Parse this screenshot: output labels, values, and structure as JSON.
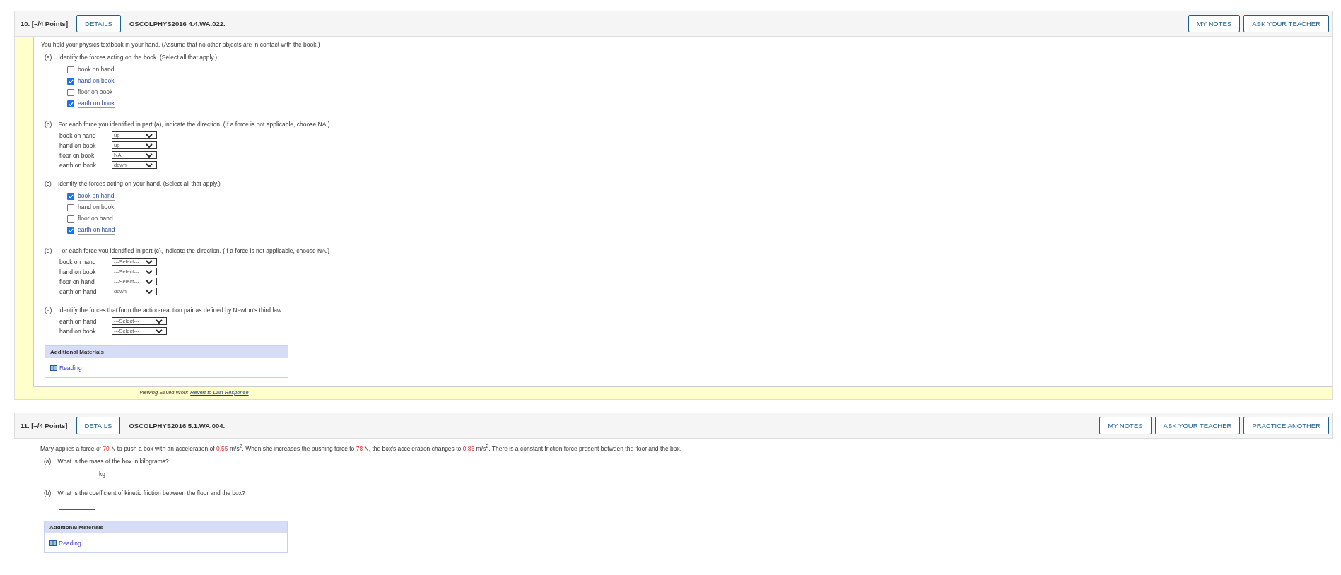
{
  "questions": [
    {
      "number": "10.",
      "points": "[–/4 Points]",
      "details": "DETAILS",
      "code": "OSCOLPHYS2016 4.4.WA.022.",
      "buttons": [
        "MY NOTES",
        "ASK YOUR TEACHER"
      ],
      "saved": true,
      "intro": [
        {
          "kind": "text",
          "text": "You hold your physics textbook in your hand. (Assume that no other objects are in contact with the book.)"
        }
      ],
      "parts": [
        {
          "label": "(a)",
          "prompt": "Identify the forces acting on the book. (Select all that apply.)",
          "kind": "checkboxes",
          "options": [
            {
              "label": "book on hand",
              "checked": false
            },
            {
              "label": "hand on book",
              "checked": true
            },
            {
              "label": "floor on book",
              "checked": false
            },
            {
              "label": "earth on book",
              "checked": true
            }
          ]
        },
        {
          "label": "(b)",
          "prompt": "For each force you identified in part (a), indicate the direction. (If a force is not applicable, choose NA.)",
          "kind": "selects",
          "rows": [
            {
              "label": "book on hand",
              "value": "up"
            },
            {
              "label": "hand on book",
              "value": "up"
            },
            {
              "label": "floor on book",
              "value": "NA"
            },
            {
              "label": "earth on book",
              "value": "down"
            }
          ]
        },
        {
          "label": "(c)",
          "prompt": "Identify the forces acting on your hand. (Select all that apply.)",
          "kind": "checkboxes",
          "options": [
            {
              "label": "book on hand",
              "checked": true
            },
            {
              "label": "hand on book",
              "checked": false
            },
            {
              "label": "floor on hand",
              "checked": false
            },
            {
              "label": "earth on hand",
              "checked": true
            }
          ]
        },
        {
          "label": "(d)",
          "prompt": "For each force you identified in part (c), indicate the direction. (If a force is not applicable, choose NA.)",
          "kind": "selects",
          "rows": [
            {
              "label": "book on hand",
              "value": "---Select---"
            },
            {
              "label": "hand on book",
              "value": "---Select---"
            },
            {
              "label": "floor on hand",
              "value": "---Select---"
            },
            {
              "label": "earth on hand",
              "value": "down"
            }
          ]
        },
        {
          "label": "(e)",
          "prompt": "Identify the forces that form the action-reaction pair as defined by Newton's third law.",
          "kind": "selects",
          "wide": true,
          "rows": [
            {
              "label": "earth on hand",
              "value": "---Select---"
            },
            {
              "label": "hand on book",
              "value": "---Select---"
            }
          ]
        }
      ],
      "materials": {
        "title": "Additional Materials",
        "link": "Reading"
      },
      "footer": {
        "note": "Viewing Saved Work",
        "link": "Revert to Last Response"
      }
    },
    {
      "number": "11.",
      "points": "[–/4 Points]",
      "details": "DETAILS",
      "code": "OSCOLPHYS2016 5.1.WA.004.",
      "buttons": [
        "MY NOTES",
        "ASK YOUR TEACHER",
        "PRACTICE ANOTHER"
      ],
      "saved": false,
      "intro": [
        {
          "kind": "text",
          "text": "Mary applies a force of "
        },
        {
          "kind": "value",
          "text": "70"
        },
        {
          "kind": "text",
          "text": " N to push a box with an acceleration of "
        },
        {
          "kind": "value",
          "text": "0.55"
        },
        {
          "kind": "text",
          "text": " m/s$^{2}$. When she increases the pushing force to "
        },
        {
          "kind": "value",
          "text": "78"
        },
        {
          "kind": "text",
          "text": " N, the box's acceleration changes to "
        },
        {
          "kind": "value",
          "text": "0.85"
        },
        {
          "kind": "text",
          "text": " m/s$^{2}$. There is a constant friction force present between the floor and the box."
        }
      ],
      "parts": [
        {
          "label": "(a)",
          "prompt": "What is the mass of the box in kilograms?",
          "kind": "answer",
          "unit": "kg"
        },
        {
          "label": "(b)",
          "prompt": "What is the coefficient of kinetic friction between the floor and the box?",
          "kind": "answer"
        }
      ],
      "materials": {
        "title": "Additional Materials",
        "link": "Reading"
      }
    }
  ]
}
